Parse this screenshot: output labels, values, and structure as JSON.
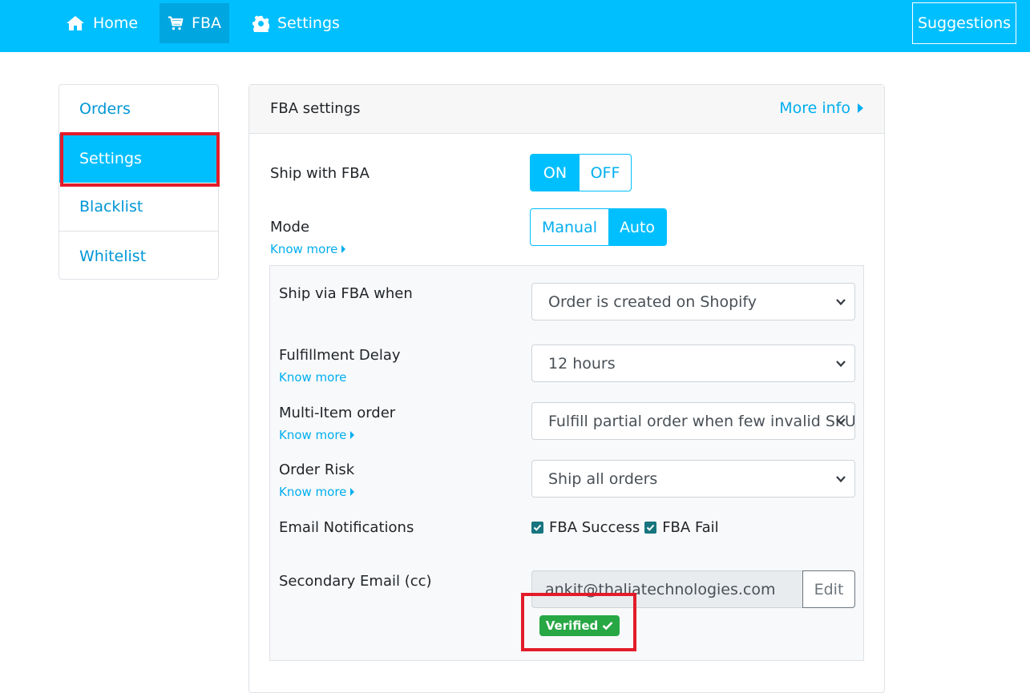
{
  "navbar": {
    "items": [
      {
        "label": "Home",
        "icon": "home-icon"
      },
      {
        "label": "FBA",
        "icon": "cart-icon"
      },
      {
        "label": "Settings",
        "icon": "gear-icon"
      }
    ],
    "suggestions_label": "Suggestions"
  },
  "sidebar": {
    "items": [
      {
        "label": "Orders"
      },
      {
        "label": "Settings"
      },
      {
        "label": "Blacklist"
      },
      {
        "label": "Whitelist"
      }
    ]
  },
  "card": {
    "title": "FBA settings",
    "more_info": "More info",
    "ship_with_fba": {
      "label": "Ship with FBA",
      "on": "ON",
      "off": "OFF",
      "selected": "ON"
    },
    "mode": {
      "label": "Mode",
      "know_more": "Know more",
      "manual": "Manual",
      "auto": "Auto",
      "selected": "Auto"
    },
    "ship_via": {
      "label": "Ship via FBA when",
      "value": "Order is created on Shopify"
    },
    "delay": {
      "label": "Fulfillment Delay",
      "know_more": "Know more",
      "value": "12 hours"
    },
    "multi_item": {
      "label": "Multi-Item order",
      "know_more": "Know more",
      "value": "Fulfill partial order when few invalid SKUs"
    },
    "order_risk": {
      "label": "Order Risk",
      "know_more": "Know more",
      "value": "Ship all orders"
    },
    "email_notifications": {
      "label": "Email Notifications",
      "success": "FBA Success",
      "fail": "FBA Fail",
      "success_checked": true,
      "fail_checked": true
    },
    "secondary_email": {
      "label": "Secondary Email (cc)",
      "value": "ankit@thaliatechnologies.com",
      "edit": "Edit",
      "verified": "Verified"
    }
  },
  "colors": {
    "brand": "#00bfff",
    "highlight": "#e21c2a",
    "verified": "#28a745"
  }
}
